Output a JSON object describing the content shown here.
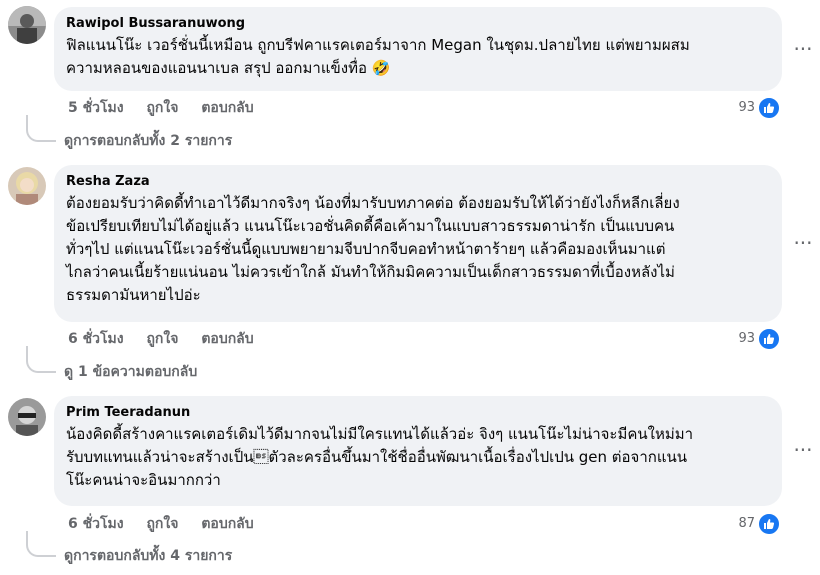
{
  "comments": [
    {
      "author": "Rawipol Bussaranuwong",
      "text": "ฟิลแนนโน๊ะ เวอร์ชั่นนี้เหมือน ถูกบรีฟคาแรคเตอร์มาจาก Megan ในชุดม.ปลายไทย แต่พยามผสม\nความหลอนของแอนนาเบล สรุป ออกมาแข็งทื่อ 🤣",
      "time": "5 ชั่วโมง",
      "like_label": "ถูกใจ",
      "reply_label": "ตอบกลับ",
      "reaction_count": "93",
      "replies_label": "ดูการตอบกลับทั้ง 2 รายการ"
    },
    {
      "author": "Resha Zaza",
      "text": "ต้องยอมรับว่าคิดดี้ทำเอาไว้ดีมากจริงๆ น้องที่มารับบทภาคต่อ ต้องยอมรับให้ได้ว่ายังไงก็หลีกเลี่ยง\nข้อเปรียบเทียบไม่ได้อยู่แล้ว แนนโน๊ะเวอชั่นคิดดี้คือเค้ามาในแบบสาวธรรมดาน่ารัก เป็นแบบคน\nทั่วๆไป แต่แนนโน๊ะเวอร์ชั่นนี้ดูแบบพยายามจีบปากจีบคอทำหน้าตาร้ายๆ แล้วคือมองเห็นมาแต่\nไกลว่าคนเนี้ยร้ายแน่นอน ไม่ควรเข้าใกล้ มันทำให้กิมมิคความเป็นเด็กสาวธรรมดาที่เบื้องหลังไม่\nธรรมดามันหายไปอ่ะ",
      "time": "6 ชั่วโมง",
      "like_label": "ถูกใจ",
      "reply_label": "ตอบกลับ",
      "reaction_count": "93",
      "replies_label": "ดู 1 ข้อความตอบกลับ"
    },
    {
      "author": "Prim Teeradanun",
      "text": "น้องคิดดี้สร้างคาแรคเตอร์เดิมไว้ดีมากจนไม่มีใครแทนได้แล้วอ่ะ จิงๆ แนนโน๊ะไม่น่าจะมีคนใหม่มา\nรับบทแทนแล้วน่าจะสร้างเป็น\bตัวละครอื่นขึ้นมาใช้ชื่ออื่นพัฒนาเนื้อเรื่องไปเปน gen ต่อจากแนน\nโน๊ะคนน่าจะอินมากกว่า",
      "time": "6 ชั่วโมง",
      "like_label": "ถูกใจ",
      "reply_label": "ตอบกลับ",
      "reaction_count": "87",
      "replies_label": "ดูการตอบกลับทั้ง 4 รายการ"
    }
  ],
  "icons": {
    "more": "more-options-icon",
    "like": "like-reaction-icon"
  },
  "colors": {
    "bubble": "#f0f2f5",
    "secondary_text": "#65676b",
    "like_blue": "#1877f2"
  }
}
